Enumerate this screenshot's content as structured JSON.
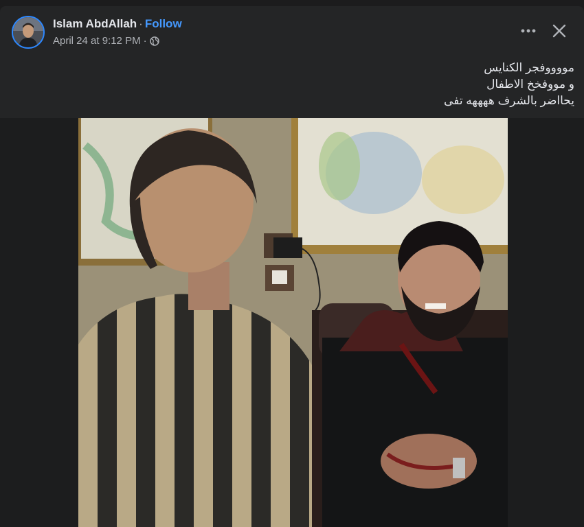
{
  "post": {
    "author": "Islam AbdAllah",
    "separator": "·",
    "follow_label": "Follow",
    "timestamp": "April 24 at 9:12 PM",
    "meta_separator": "·",
    "privacy_icon": "globe-icon",
    "caption_lines": [
      "مووووفجر الكنايس",
      "و مووفخخ الاطفال",
      "يحااضر بالشرف ههههه تفى"
    ]
  },
  "icons": {
    "more": "more-options-icon",
    "close": "close-icon"
  },
  "colors": {
    "card_bg": "#242526",
    "accent": "#4599ff",
    "text": "#e4e6eb",
    "secondary_text": "#b0b3b8"
  }
}
